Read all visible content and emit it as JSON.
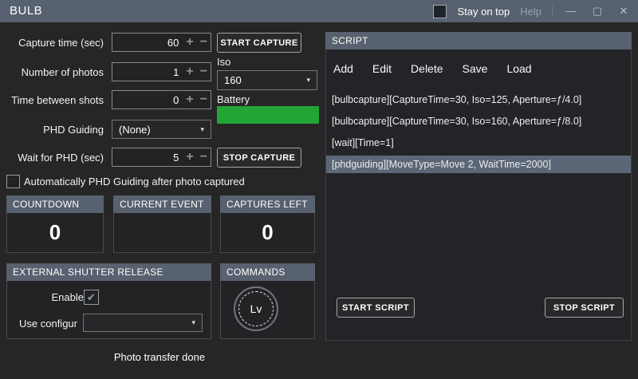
{
  "titlebar": {
    "title": "BULB",
    "stay_on_top": "Stay on top",
    "help": "Help",
    "minimize": "—",
    "maximize": "▢",
    "close": "✕"
  },
  "form": {
    "capture_time_label": "Capture time (sec)",
    "capture_time_value": "60",
    "num_photos_label": "Number of photos",
    "num_photos_value": "1",
    "time_between_label": "Time between shots",
    "time_between_value": "0",
    "phd_guiding_label": "PHD Guiding",
    "phd_guiding_value": "(None)",
    "wait_phd_label": "Wait for PHD (sec)",
    "wait_phd_value": "5",
    "start_capture": "START CAPTURE",
    "stop_capture": "STOP CAPTURE",
    "iso_label": "Iso",
    "iso_value": "160",
    "battery_label": "Battery",
    "battery_percent": 100,
    "auto_phd_label": "Automatically PHD Guiding after photo captured",
    "stepper_plus": "+",
    "stepper_minus": "−",
    "dropdown_caret": "▾"
  },
  "status_boxes": {
    "countdown_title": "COUNTDOWN",
    "countdown_value": "0",
    "current_event_title": "CURRENT EVENT",
    "current_event_value": "",
    "captures_left_title": "CAPTURES LEFT",
    "captures_left_value": "0"
  },
  "shutter_release": {
    "title": "EXTERNAL SHUTTER RELEASE",
    "enable_label": "Enable",
    "enable_checked": true,
    "checkmark": "✔",
    "use_config_label": "Use configur",
    "use_config_value": ""
  },
  "commands": {
    "title": "COMMANDS",
    "lv_button": "Lv"
  },
  "status_text": "Photo transfer done",
  "script_panel": {
    "title": "SCRIPT",
    "menu": [
      "Add",
      "Edit",
      "Delete",
      "Save",
      "Load"
    ],
    "items": [
      "[bulbcapture][CaptureTime=30, Iso=125, Aperture=ƒ/4.0]",
      "[bulbcapture][CaptureTime=30, Iso=160, Aperture=ƒ/8.0]",
      "[wait][Time=1]",
      "[phdguiding][MoveType=Move 2, WaitTime=2000]"
    ],
    "selected_index": 3,
    "start_script": "START SCRIPT",
    "stop_script": "STOP SCRIPT"
  },
  "colors": {
    "titlebar_bg": "#57616f",
    "group_header_bg": "#57616f",
    "window_bg": "#262627",
    "battery_green": "#22a535",
    "selected_item_bg": "#5b6777"
  }
}
